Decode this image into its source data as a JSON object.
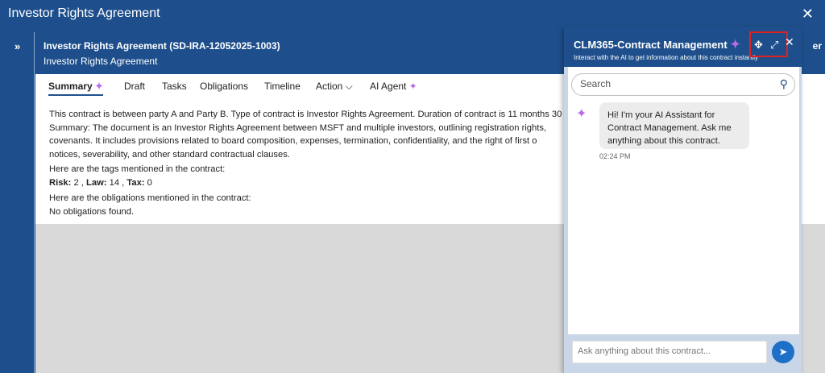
{
  "window": {
    "title": "Investor Rights Agreement",
    "close": "✕"
  },
  "sidebar": {
    "expand_icon": "»"
  },
  "header": {
    "title": "Investor Rights Agreement (SD-IRA-12052025-1003)",
    "subtitle": "Investor Rights Agreement",
    "right_text": "er"
  },
  "tabs": [
    {
      "label": "Summary"
    },
    {
      "label": "Draft"
    },
    {
      "label": "Tasks"
    },
    {
      "label": "Obligations"
    },
    {
      "label": "Timeline"
    },
    {
      "label": "Action ⌵"
    },
    {
      "label": "AI Agent"
    }
  ],
  "summary": {
    "line1": "This contract is between party A and Party B. Type of contract is Investor Rights Agreement. Duration of contract is 11 months 30",
    "line2": "Summary: The document is an Investor Rights Agreement between MSFT and multiple investors, outlining registration rights,",
    "line3": "covenants. It includes provisions related to board composition, expenses, termination, confidentiality, and the right of first o",
    "line4": "notices, severability, and other standard contractual clauses.",
    "tags_intro": "Here are the tags mentioned in the contract:",
    "risk_label": "Risk:",
    "risk_value": " 2 , ",
    "law_label": "Law:",
    "law_value": " 14 , ",
    "tax_label": "Tax:",
    "tax_value": " 0",
    "obligations_intro": "Here are the obligations mentioned in the contract:",
    "obligations_value": "No obligations found."
  },
  "chat": {
    "title": "CLM365-Contract Management",
    "subtitle": "Interact with the AI to get information about this contract instantly",
    "move_icon": "✥",
    "expand_icon": "⤢",
    "close_icon": "✕",
    "search_placeholder": "Search",
    "message": "Hi! I'm your AI Assistant for Contract Management. Ask me anything about this contract.",
    "time": "02:24 PM",
    "input_placeholder": "Ask anything about this contract...",
    "send_icon": "➤"
  },
  "colors": {
    "primary": "#1e4f8c",
    "accent_sparkle": "#b86ce8",
    "send": "#1e6fc8"
  }
}
